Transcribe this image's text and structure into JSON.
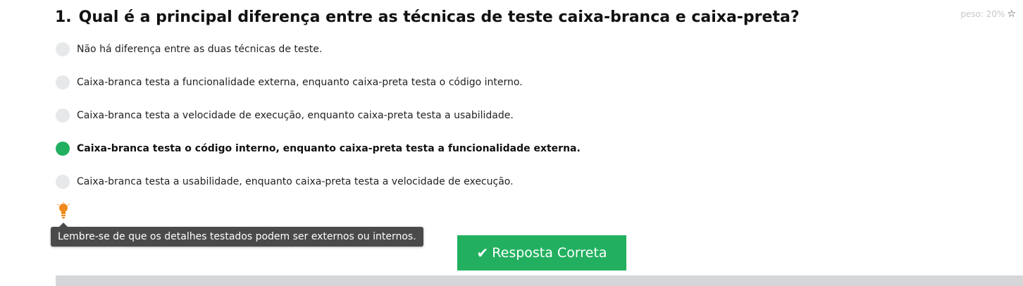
{
  "question": {
    "number": "1.",
    "text": "Qual é a principal diferença entre as técnicas de teste caixa-branca e caixa-preta?",
    "weight_label": "peso: 20%",
    "star_icon": "☆"
  },
  "options": [
    {
      "label": "Não há diferença entre as duas técnicas de teste.",
      "selected": false
    },
    {
      "label": "Caixa-branca testa a funcionalidade externa, enquanto caixa-preta testa o código interno.",
      "selected": false
    },
    {
      "label": "Caixa-branca testa a velocidade de execução, enquanto caixa-preta testa a usabilidade.",
      "selected": false
    },
    {
      "label": "Caixa-branca testa o código interno, enquanto caixa-preta testa a funcionalidade externa.",
      "selected": true
    },
    {
      "label": "Caixa-branca testa a usabilidade, enquanto caixa-preta testa a velocidade de execução.",
      "selected": false
    }
  ],
  "hint": {
    "icon": "lightbulb-icon",
    "tooltip": "Lembre-se de que os detalhes testados podem ser externos ou internos."
  },
  "answer_button": {
    "icon": "✔",
    "label": "Resposta Correta"
  },
  "colors": {
    "accent_green": "#22b060",
    "radio_unselected": "#e6e8ea",
    "tooltip_bg": "#4a4a4a",
    "hint_orange": "#f08a1c"
  }
}
